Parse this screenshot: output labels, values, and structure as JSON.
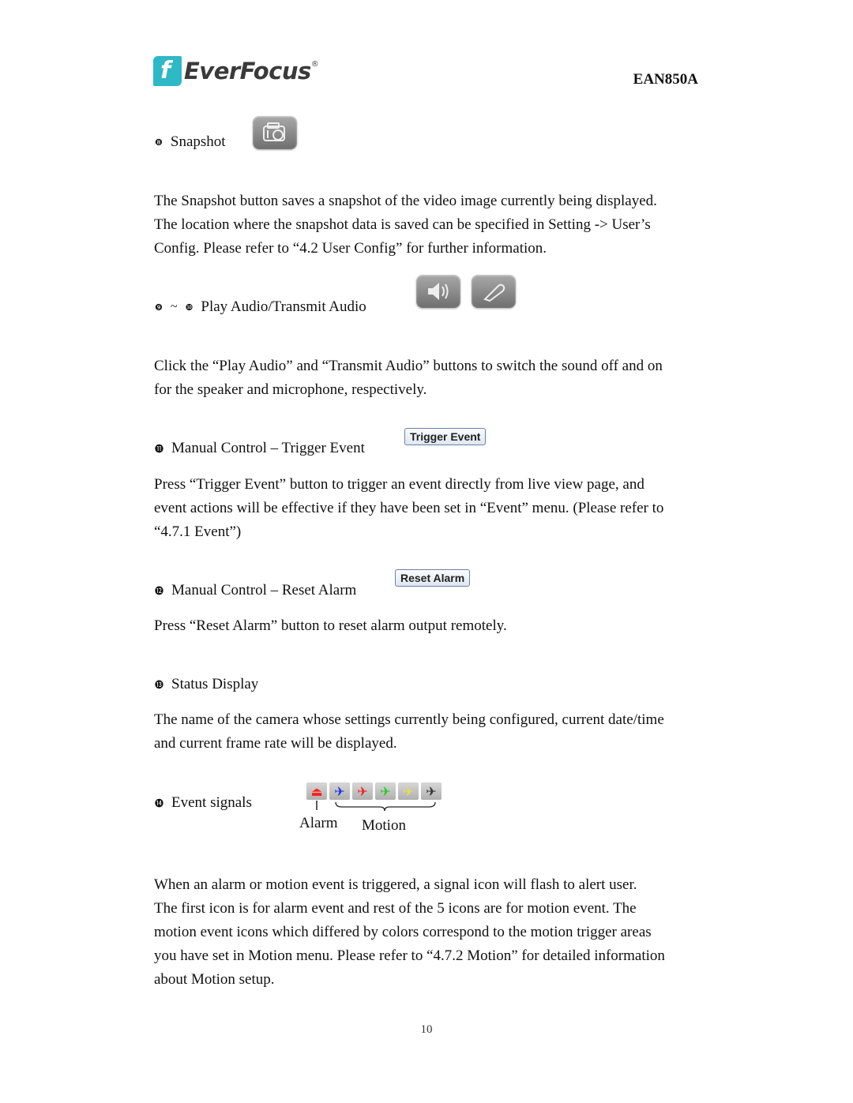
{
  "header": {
    "brand": "EverFocus",
    "brand_registered": "®",
    "logo_letter": "f",
    "model": "EAN850A"
  },
  "sections": [
    {
      "bullet": "❽",
      "title": "Snapshot",
      "icon": "camera-icon",
      "body": [
        "The Snapshot button saves a snapshot of the video image currently being displayed.",
        "The location where the snapshot data is saved can be specified in Setting -> User’s",
        "Config. Please refer to “4.2 User Config” for further information."
      ]
    },
    {
      "bullet": "❾",
      "tilde": "~",
      "bullet2": "❿",
      "title": "Play Audio/Transmit Audio",
      "icons": [
        "speaker-icon",
        "microphone-icon"
      ],
      "body": [
        "Click the “Play Audio” and “Transmit Audio” buttons to switch the sound off and on",
        "for the speaker and microphone, respectively."
      ]
    },
    {
      "bullet": "⓫",
      "title": "Manual Control – Trigger Event",
      "button_label": "Trigger Event",
      "body": [
        "Press “Trigger Event” button to trigger an event directly from live view page, and",
        "event actions will be effective if they have been set in “Event” menu. (Please refer to",
        "“4.7.1 Event”)"
      ]
    },
    {
      "bullet": "⓬",
      "title": "Manual Control – Reset Alarm",
      "button_label": "Reset Alarm",
      "body": [
        "Press “Reset Alarm” button to reset alarm output remotely."
      ]
    },
    {
      "bullet": "⓭",
      "title": "Status Display",
      "body": [
        "The name of the camera whose settings currently being configured, current date/time",
        "and current frame rate will be displayed."
      ]
    },
    {
      "bullet": "⓮",
      "title": "Event signals",
      "alarm_label": "Alarm",
      "motion_label": "Motion",
      "signal_icons": [
        {
          "name": "alarm-icon",
          "glyph": "♟",
          "color": "#ff2020"
        },
        {
          "name": "motion-icon-blue",
          "glyph": "🏃",
          "color": "#2233dd"
        },
        {
          "name": "motion-icon-red",
          "glyph": "🏃",
          "color": "#ee2222"
        },
        {
          "name": "motion-icon-green",
          "glyph": "🏃",
          "color": "#22cc22"
        },
        {
          "name": "motion-icon-yellow",
          "glyph": "🏃",
          "color": "#e8e040"
        },
        {
          "name": "motion-icon-gray",
          "glyph": "🏃",
          "color": "#333333"
        }
      ],
      "body": [
        "When an alarm or motion event is triggered, a signal icon will flash to alert user.",
        "The first icon is for alarm event and rest of the 5 icons are for motion event. The",
        "motion event icons which differed by colors correspond to the motion trigger areas",
        "you have set in Motion menu. Please refer to “4.7.2 Motion” for detailed information",
        "about Motion setup."
      ]
    }
  ],
  "footer": {
    "page_number": "10"
  }
}
